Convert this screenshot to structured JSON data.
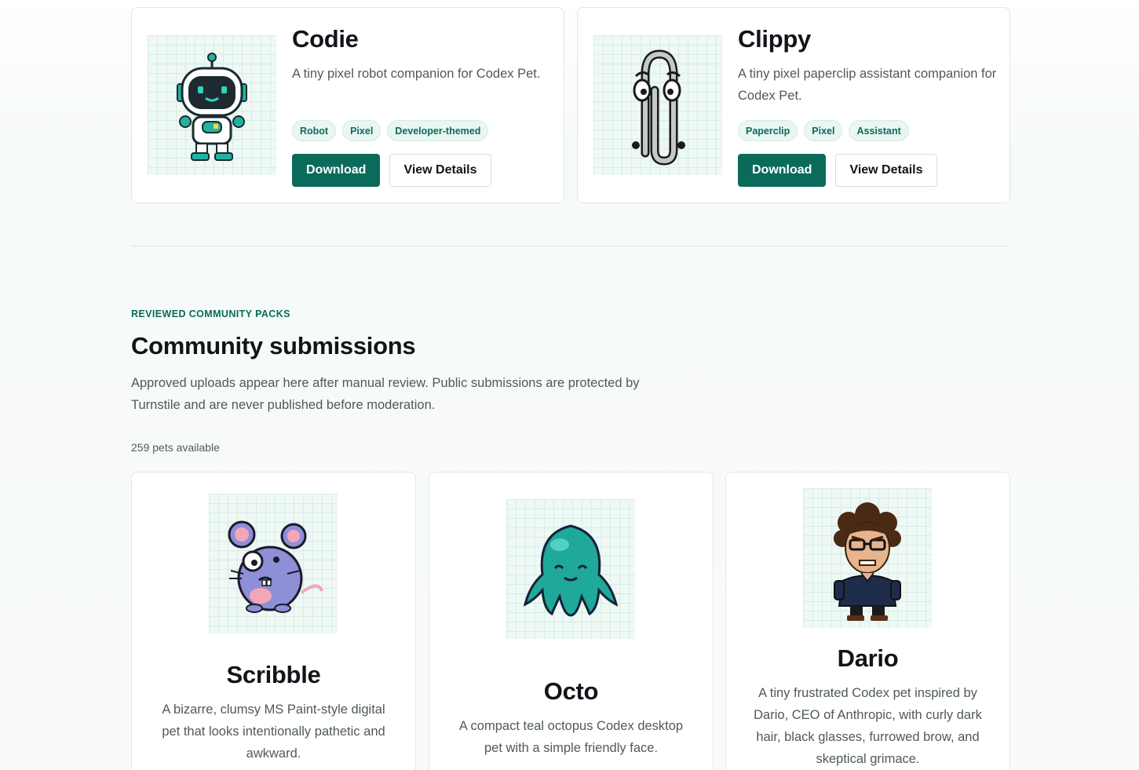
{
  "featured": [
    {
      "name": "Codie",
      "description": "A tiny pixel robot companion for Codex Pet.",
      "tags": [
        "Robot",
        "Pixel",
        "Developer-themed"
      ],
      "download_label": "Download",
      "details_label": "View Details",
      "icon": "robot-pet-icon"
    },
    {
      "name": "Clippy",
      "description": "A tiny pixel paperclip assistant companion for Codex Pet.",
      "tags": [
        "Paperclip",
        "Pixel",
        "Assistant"
      ],
      "download_label": "Download",
      "details_label": "View Details",
      "icon": "paperclip-pet-icon"
    }
  ],
  "community": {
    "eyebrow": "REVIEWED COMMUNITY PACKS",
    "title": "Community submissions",
    "description": "Approved uploads appear here after manual review. Public submissions are protected by Turnstile and are never published before moderation.",
    "count_label": "259 pets available",
    "pets": [
      {
        "name": "Scribble",
        "description": "A bizarre, clumsy MS Paint-style digital pet that looks intentionally pathetic and awkward.",
        "icon": "mouse-pet-icon"
      },
      {
        "name": "Octo",
        "description": "A compact teal octopus Codex desktop pet with a simple friendly face.",
        "icon": "octopus-pet-icon"
      },
      {
        "name": "Dario",
        "description": "A tiny frustrated Codex pet inspired by Dario, CEO of Anthropic, with curly dark hair, black glasses, furrowed brow, and skeptical grimace.",
        "icon": "person-pet-icon"
      }
    ]
  },
  "colors": {
    "accent": "#0b6b5a",
    "tag_bg": "#eaf6f2",
    "thumb_bg": "#eef8f5"
  }
}
